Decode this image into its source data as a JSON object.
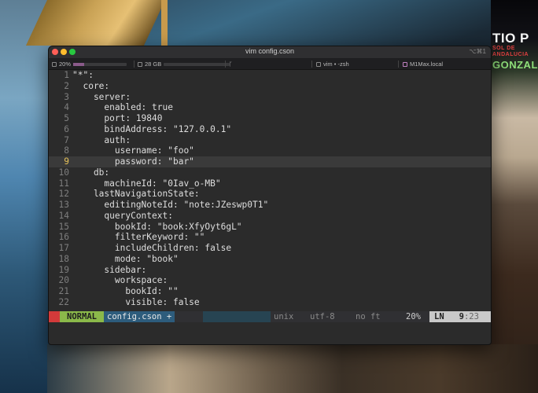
{
  "window": {
    "title": "vim config.cson",
    "shortcut": "⌥⌘1"
  },
  "statusbar": {
    "cpu_label": "20%",
    "cpu_level": 0.2,
    "disk_label": "28 GB",
    "branch_icon": "git-branch-icon",
    "session_label": "vim • -zsh",
    "host_label": "M1Max.local"
  },
  "editor": {
    "cursor_line": 9,
    "lines": [
      {
        "n": "1",
        "text": "\"*\":"
      },
      {
        "n": "2",
        "text": "  core:"
      },
      {
        "n": "3",
        "text": "    server:"
      },
      {
        "n": "4",
        "text": "      enabled: true"
      },
      {
        "n": "5",
        "text": "      port: 19840"
      },
      {
        "n": "6",
        "text": "      bindAddress: \"127.0.0.1\""
      },
      {
        "n": "7",
        "text": "      auth:"
      },
      {
        "n": "8",
        "text": "        username: \"foo\""
      },
      {
        "n": "9",
        "text": "        password: \"bar\""
      },
      {
        "n": "10",
        "text": "    db:"
      },
      {
        "n": "11",
        "text": "      machineId: \"0Iav_o-MB\""
      },
      {
        "n": "12",
        "text": "    lastNavigationState:"
      },
      {
        "n": "13",
        "text": "      editingNoteId: \"note:JZeswp0T1\""
      },
      {
        "n": "14",
        "text": "      queryContext:"
      },
      {
        "n": "15",
        "text": "        bookId: \"book:XfyOyt6gL\""
      },
      {
        "n": "16",
        "text": "        filterKeyword: \"\""
      },
      {
        "n": "17",
        "text": "        includeChildren: false"
      },
      {
        "n": "18",
        "text": "        mode: \"book\""
      },
      {
        "n": "19",
        "text": "      sidebar:"
      },
      {
        "n": "20",
        "text": "        workspace:"
      },
      {
        "n": "21",
        "text": "          bookId: \"\""
      },
      {
        "n": "22",
        "text": "          visible: false"
      }
    ]
  },
  "vim_status": {
    "mode": "NORMAL",
    "filename": "config.cson",
    "modified": "+",
    "fileformat": "unix",
    "encoding": "utf-8",
    "filetype": "no ft",
    "percent": "20%",
    "ln_label": "LN",
    "line": "9",
    "col": ":23"
  },
  "backdrop": {
    "sign_top": "TIO P",
    "sign_small": "SOL DE ANDALUCIA",
    "sign_bottom": "GONZALE"
  },
  "colors": {
    "mode_bg": "#8bb94a",
    "filename_bg": "#2d5c7c",
    "cursor_line_number": "#e6c25a"
  }
}
